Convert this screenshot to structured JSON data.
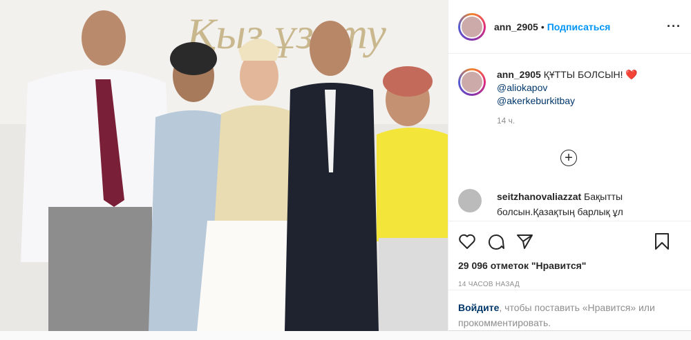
{
  "post": {
    "username": "ann_2905",
    "separator": "•",
    "follow_label": "Подписаться",
    "more_label": "···"
  },
  "caption": {
    "username": "ann_2905",
    "text": "ҚҰТТЫ БОЛСЫН! ❤️",
    "mentions": [
      "@aliokapov",
      "@akerkeburkitbay"
    ],
    "time": "14 ч."
  },
  "comment2": {
    "username": "seitzhanovaliazzat",
    "text": "Бақытты болсын.Қазақтың барлық ұл"
  },
  "photo": {
    "banner_text": "Қыз ұзату"
  },
  "actions": {
    "likes": "29 096 отметок \"Нравится\"",
    "ago": "14 часов назад"
  },
  "login": {
    "link": "Войдите",
    "text": ", чтобы поставить «Нравится» или прокомментировать."
  },
  "colors": {
    "accent": "#0095f6",
    "link": "#00376b",
    "muted": "#8e8e8e"
  }
}
